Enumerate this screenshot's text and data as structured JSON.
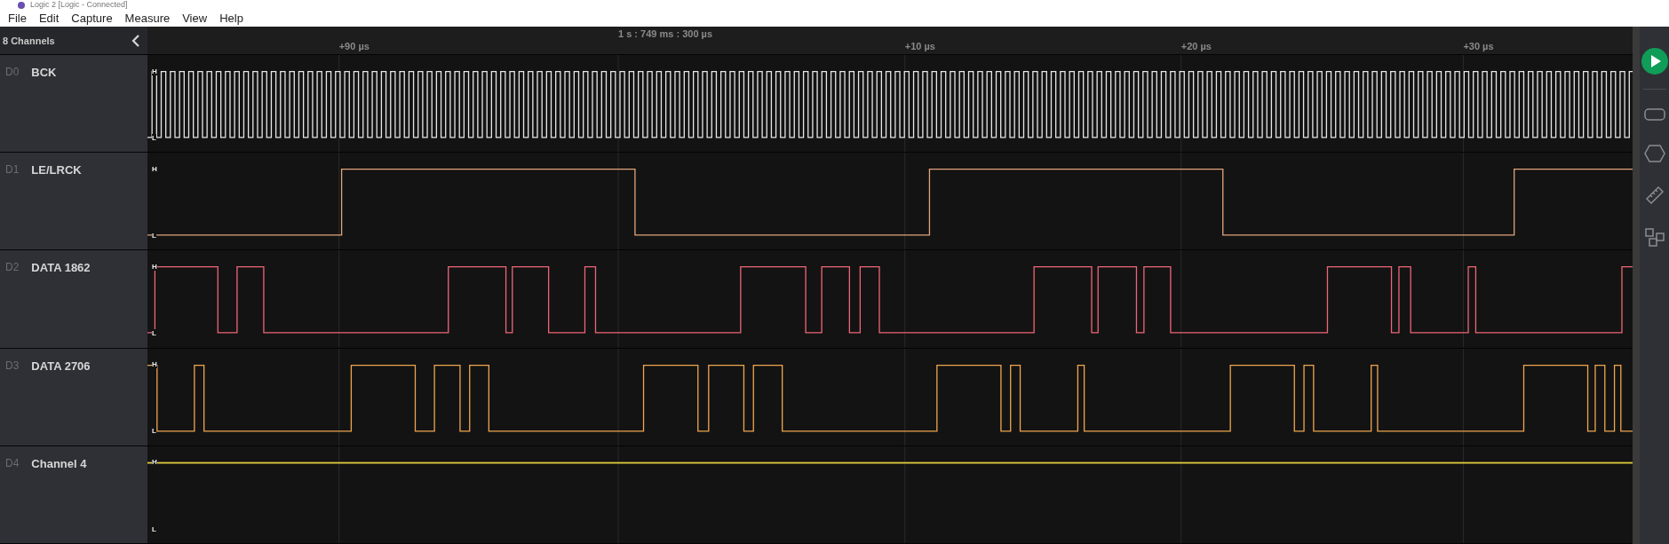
{
  "window": {
    "title": "Logic 2 [Logic - Connected]"
  },
  "menu": [
    "File",
    "Edit",
    "Capture",
    "Measure",
    "View",
    "Help"
  ],
  "channels_panel": {
    "title": "8 Channels"
  },
  "timeline": {
    "marker": "1 s : 749 ms : 300 µs",
    "ticks": [
      "+90 µs",
      "+10 µs",
      "+20 µs",
      "+30 µs"
    ]
  },
  "channels": [
    {
      "id": "D0",
      "name": "BCK",
      "color": "#e6e6e6",
      "high_label": "H",
      "low_label": "L"
    },
    {
      "id": "D1",
      "name": "LE/LRCK",
      "color": "#e0a47c",
      "high_label": "H",
      "low_label": "L"
    },
    {
      "id": "D2",
      "name": "DATA 1862",
      "color": "#ee6677",
      "high_label": "H",
      "low_label": "L"
    },
    {
      "id": "D3",
      "name": "DATA 2706",
      "color": "#f0a64e",
      "high_label": "H",
      "low_label": "L"
    },
    {
      "id": "D4",
      "name": "Channel 4",
      "color": "#e8d23a",
      "high_label": "H",
      "low_label": "L"
    }
  ]
}
